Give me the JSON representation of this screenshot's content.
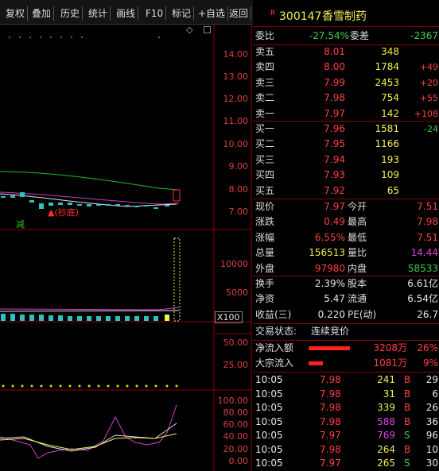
{
  "toolbar": {
    "items": [
      "复权",
      "叠加",
      "历史",
      "统计",
      "画线",
      "F10",
      "标记",
      "+自选",
      "返回"
    ]
  },
  "stock": {
    "marker": "R",
    "code": "300147",
    "name": "香雪制药"
  },
  "weibi": {
    "label": "委比",
    "value": "-27.54%",
    "label2": "委差",
    "value2": "-2367"
  },
  "asks": [
    {
      "label": "卖五",
      "price": "8.01",
      "vol": "348",
      "chg": ""
    },
    {
      "label": "卖四",
      "price": "8.00",
      "vol": "1784",
      "chg": "+49"
    },
    {
      "label": "卖三",
      "price": "7.99",
      "vol": "2453",
      "chg": "+20"
    },
    {
      "label": "卖二",
      "price": "7.98",
      "vol": "754",
      "chg": "+55"
    },
    {
      "label": "卖一",
      "price": "7.97",
      "vol": "142",
      "chg": "+108"
    }
  ],
  "bids": [
    {
      "label": "买一",
      "price": "7.96",
      "vol": "1581",
      "chg": "-24"
    },
    {
      "label": "买二",
      "price": "7.95",
      "vol": "1166",
      "chg": ""
    },
    {
      "label": "买三",
      "price": "7.94",
      "vol": "193",
      "chg": ""
    },
    {
      "label": "买四",
      "price": "7.93",
      "vol": "109",
      "chg": ""
    },
    {
      "label": "买五",
      "price": "7.92",
      "vol": "65",
      "chg": ""
    }
  ],
  "quote": {
    "rows": [
      {
        "l1": "现价",
        "v1": "7.97",
        "c1": "r",
        "l2": "今开",
        "v2": "7.51",
        "c2": "r"
      },
      {
        "l1": "涨跌",
        "v1": "0.49",
        "c1": "r",
        "l2": "最高",
        "v2": "7.98",
        "c2": "r"
      },
      {
        "l1": "涨幅",
        "v1": "6.55%",
        "c1": "r",
        "l2": "最低",
        "v2": "7.51",
        "c2": "r"
      },
      {
        "l1": "总量",
        "v1": "156513",
        "c1": "y",
        "l2": "量比",
        "v2": "14.44",
        "c2": "m"
      },
      {
        "l1": "外盘",
        "v1": "97980",
        "c1": "r",
        "l2": "内盘",
        "v2": "58533",
        "c2": "g"
      }
    ],
    "rows2": [
      {
        "l1": "换手",
        "v1": "2.39%",
        "l2": "股本",
        "v2": "6.61亿"
      },
      {
        "l1": "净资",
        "v1": "5.47",
        "l2": "流通",
        "v2": "6.54亿"
      },
      {
        "l1": "收益(三)",
        "v1": "0.220",
        "l2": "PE(动)",
        "v2": "26.7"
      }
    ]
  },
  "trade_status": {
    "label": "交易状态:",
    "value": "连续竞价"
  },
  "flows": [
    {
      "label": "净流入额",
      "amount": "3208万",
      "pct": "26%",
      "bar": 0.26
    },
    {
      "label": "大宗流入",
      "amount": "1081万",
      "pct": "9%",
      "bar": 0.09
    }
  ],
  "ticks": [
    {
      "time": "10:05",
      "price": "7.98",
      "vol": "241",
      "vcolor": "y",
      "bs": "B",
      "n": "29"
    },
    {
      "time": "10:05",
      "price": "7.98",
      "vol": "31",
      "vcolor": "y",
      "bs": "B",
      "n": "6"
    },
    {
      "time": "10:05",
      "price": "7.98",
      "vol": "339",
      "vcolor": "y",
      "bs": "B",
      "n": "26"
    },
    {
      "time": "10:05",
      "price": "7.98",
      "vol": "588",
      "vcolor": "m",
      "bs": "B",
      "n": "36"
    },
    {
      "time": "10:05",
      "price": "7.97",
      "vol": "769",
      "vcolor": "m",
      "bs": "S",
      "n": "96"
    },
    {
      "time": "10:05",
      "price": "7.98",
      "vol": "264",
      "vcolor": "y",
      "bs": "B",
      "n": "10"
    },
    {
      "time": "10:05",
      "price": "7.97",
      "vol": "265",
      "vcolor": "y",
      "bs": "S",
      "n": "30"
    }
  ],
  "price_axis": [
    "14.00",
    "13.00",
    "12.00",
    "11.00",
    "10.00",
    "9.00",
    "8.00",
    "7.00"
  ],
  "volume_axis": [
    "10000",
    "5000"
  ],
  "volume_unit": "X100",
  "indicator_axis": [
    "50.00",
    "25.00"
  ],
  "kdj_axis": [
    "100.00",
    "80.00",
    "60.00",
    "40.00",
    "20.00",
    "0.00"
  ],
  "annotations": {
    "jian": "减",
    "chaodi": "(抄底)"
  },
  "colors": {
    "up": "#ff3030",
    "down": "#30c0c0",
    "grid": "#7a0000",
    "ma_green": "#20c020",
    "ma_white": "#e0e0e0",
    "ma_magenta": "#d040d0"
  }
}
